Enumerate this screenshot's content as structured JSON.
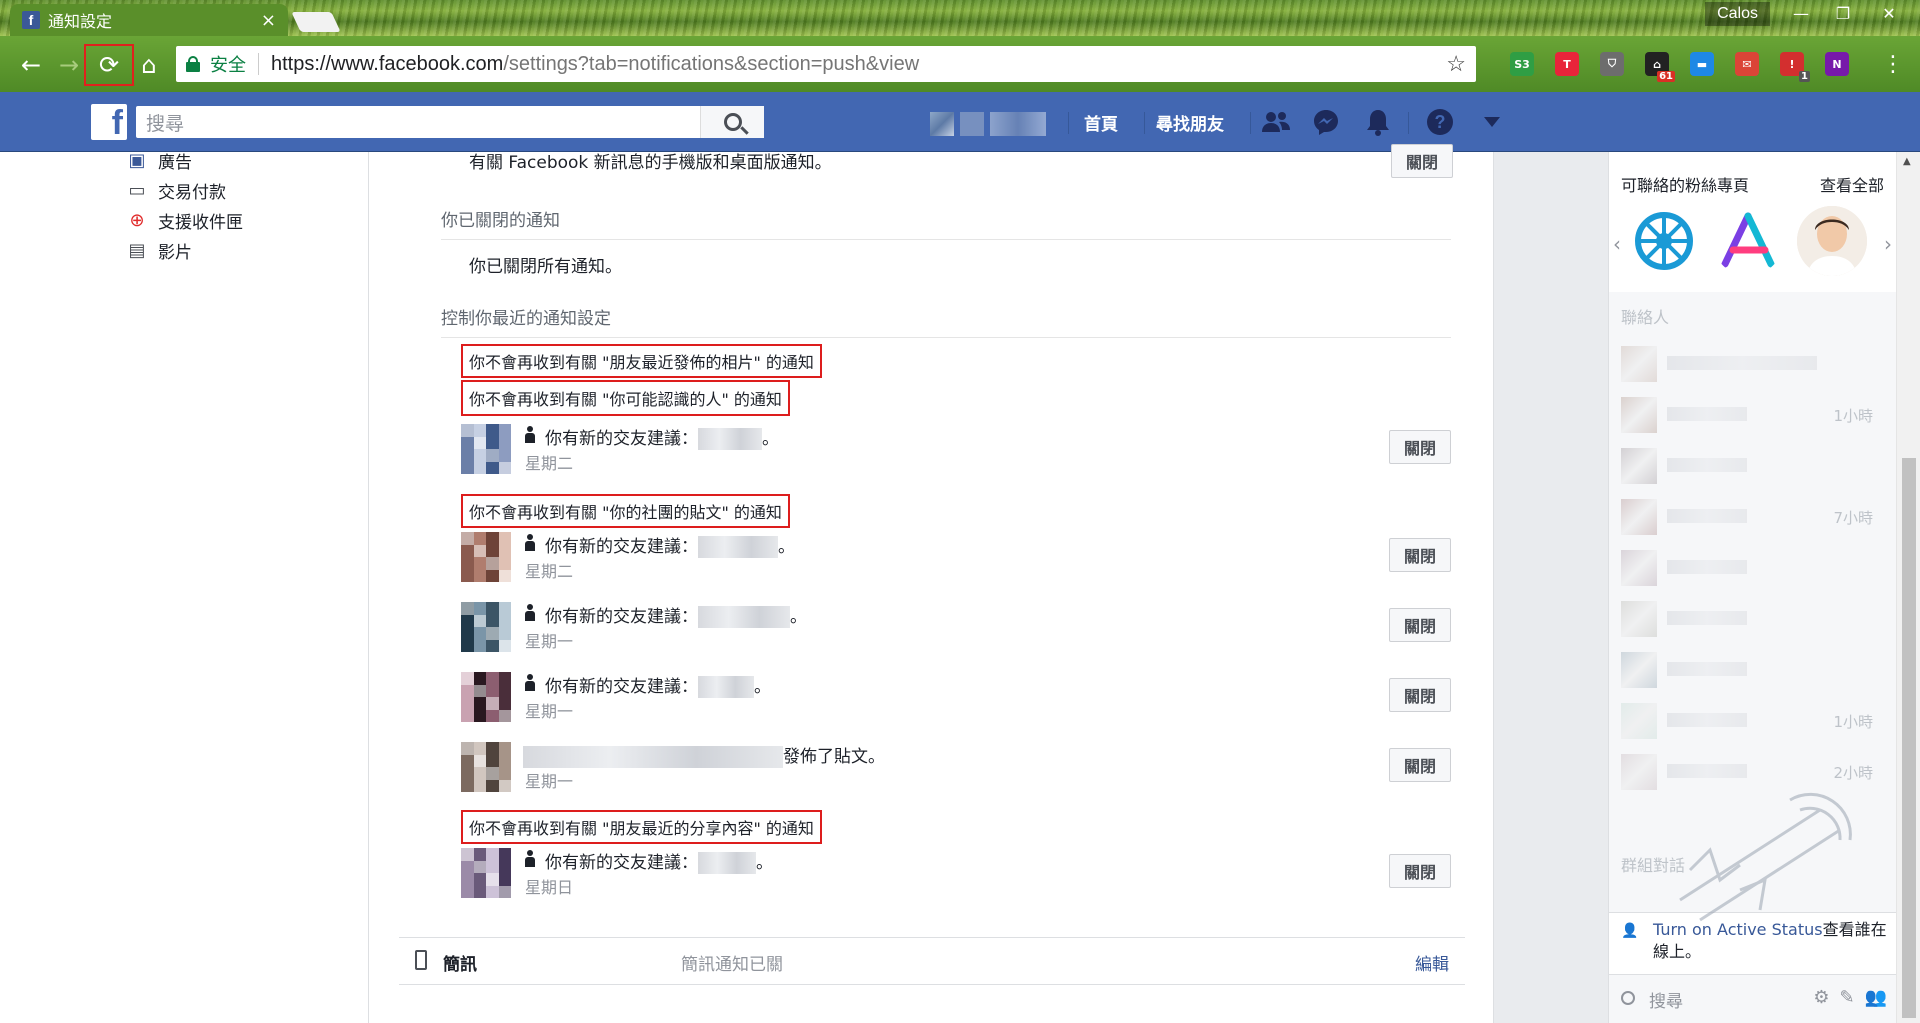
{
  "browser": {
    "tab_title": "通知設定",
    "tab_favicon": "f",
    "tab_close": "×",
    "profile_name": "Calos",
    "window_controls": [
      "—",
      "❐",
      "✕"
    ],
    "nav": {
      "back": "←",
      "forward": "→",
      "reload": "⟳",
      "home": "⌂"
    },
    "omnibox": {
      "secure_label": "安全",
      "url_host": "https://www.facebook.com",
      "url_rest": "/settings?tab=notifications&section=push&view",
      "star": "☆"
    },
    "extensions": [
      {
        "name": "s3-extension-icon",
        "label": "S3",
        "color": "#2f9e44"
      },
      {
        "name": "t-extension-icon",
        "label": "T",
        "color": "#e8243a"
      },
      {
        "name": "pocket-extension-icon",
        "label": "⛉",
        "color": "#6d6d6d"
      },
      {
        "name": "home-extension-icon",
        "label": "⌂",
        "color": "#222222",
        "badge": "61",
        "badge_color": "#d93025"
      },
      {
        "name": "calendar-extension-icon",
        "label": "▬",
        "color": "#1e88e5"
      },
      {
        "name": "gmail-extension-icon",
        "label": "✉",
        "color": "#db4437"
      },
      {
        "name": "lastpass-extension-icon",
        "label": "!",
        "color": "#d32f2f",
        "badge": "1",
        "badge_color": "#555555"
      },
      {
        "name": "onenote-extension-icon",
        "label": "N",
        "color": "#7719aa"
      }
    ],
    "menu": "⋮"
  },
  "fb": {
    "logo": "f",
    "search_placeholder": "搜尋",
    "nav_home": "首頁",
    "nav_find_friends": "尋找朋友",
    "icons": [
      "friends-icon",
      "messenger-icon",
      "notifications-icon",
      "help-icon",
      "account-menu-icon"
    ]
  },
  "leftnav": [
    {
      "icon": "ads-icon",
      "glyph": "▣",
      "label": "廣告"
    },
    {
      "icon": "payments-icon",
      "glyph": "▭",
      "label": "交易付款"
    },
    {
      "icon": "support-inbox-icon",
      "glyph": "⊕",
      "label": "支援收件匣"
    },
    {
      "icon": "videos-icon",
      "glyph": "▤",
      "label": "影片"
    }
  ],
  "main": {
    "top_text": "有關 Facebook 新訊息的手機版和桌面版通知。",
    "top_button": "關閉",
    "section_off_title": "你已關閉的通知",
    "section_off_text": "你已關閉所有通知。",
    "section_recent_title": "控制你最近的通知設定",
    "highlight_1": "你不會再收到有關 \"朋友最近發佈的相片\" 的通知",
    "highlight_2": "你不會再收到有關 \"你可能認識的人\" 的通知",
    "highlight_3": "你不會再收到有關 \"你的社團的貼文\" 的通知",
    "highlight_4": "你不會再收到有關 \"朋友最近的分享內容\" 的通知",
    "notifications": [
      {
        "text": "你有新的交友建議：",
        "suffix": "。",
        "time": "星期二",
        "button": "關閉"
      },
      {
        "text": "你有新的交友建議：",
        "suffix": "。",
        "time": "星期二",
        "button": "關閉"
      },
      {
        "text": "你有新的交友建議：",
        "suffix": "。",
        "time": "星期一",
        "button": "關閉"
      },
      {
        "text": "你有新的交友建議：",
        "suffix": "。",
        "time": "星期一",
        "button": "關閉"
      },
      {
        "text": "發佈了貼文。",
        "suffix": "",
        "time": "星期一",
        "button": "關閉"
      },
      {
        "text": "你有新的交友建議：",
        "suffix": "。",
        "time": "星期日",
        "button": "關閉"
      }
    ],
    "sms": {
      "title": "簡訊",
      "status": "簡訊通知已關",
      "edit": "編輯"
    }
  },
  "chat": {
    "pages_title": "可聯絡的粉絲專頁",
    "see_all": "查看全部",
    "contacts_title": "聯絡人",
    "contact_times": [
      "",
      "1小時",
      "",
      "7小時",
      "",
      "",
      "",
      "1小時",
      "2小時"
    ],
    "group_title": "群組對話",
    "active_link": "Turn on Active Status",
    "active_rest": "查看誰在線上。",
    "search_placeholder": "搜尋"
  },
  "colors": {
    "fb_blue": "#4267b2",
    "highlight_red": "#dd1d1d",
    "link_blue": "#385898"
  }
}
